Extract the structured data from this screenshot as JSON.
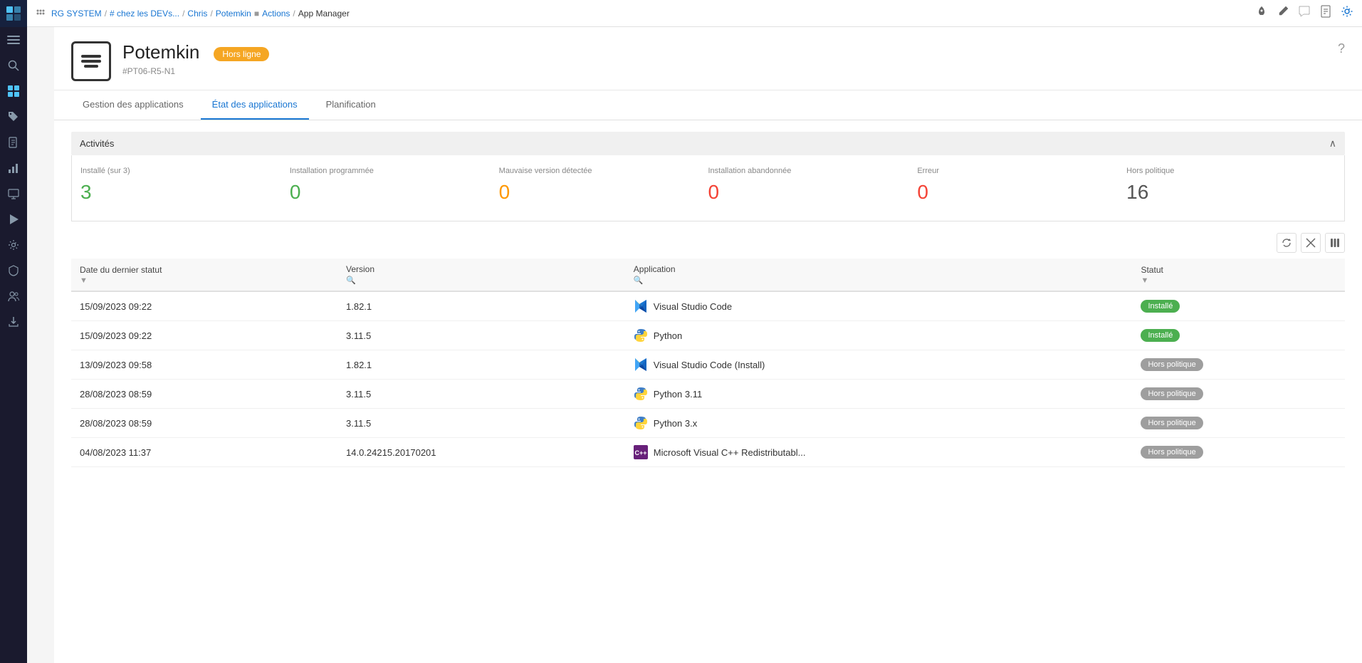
{
  "topbar": {
    "breadcrumb": [
      {
        "label": "RG SYSTEM",
        "type": "link"
      },
      {
        "label": "# chez les DEVs...",
        "type": "link"
      },
      {
        "label": "Chris",
        "type": "link"
      },
      {
        "label": "Potemkin",
        "type": "link"
      },
      {
        "label": "Actions",
        "type": "separator"
      },
      {
        "label": "App Manager",
        "type": "current"
      }
    ]
  },
  "page": {
    "device_id": "#PT06-R5-N1",
    "title": "Potemkin",
    "status": "Hors ligne",
    "help_label": "?"
  },
  "tabs": [
    {
      "label": "Gestion des applications",
      "active": false
    },
    {
      "label": "État des applications",
      "active": true
    },
    {
      "label": "Planification",
      "active": false
    }
  ],
  "activities": {
    "title": "Activités",
    "items": [
      {
        "label": "Installé (sur 3)",
        "value": "3",
        "color": "green"
      },
      {
        "label": "Installation programmée",
        "value": "0",
        "color": "green"
      },
      {
        "label": "Mauvaise version détectée",
        "value": "0",
        "color": "orange"
      },
      {
        "label": "Installation abandonnée",
        "value": "0",
        "color": "red"
      },
      {
        "label": "Erreur",
        "value": "0",
        "color": "red"
      },
      {
        "label": "Hors politique",
        "value": "16",
        "color": "dark"
      }
    ]
  },
  "table": {
    "columns": [
      {
        "label": "Date du dernier statut",
        "has_filter": true,
        "has_search": false
      },
      {
        "label": "Version",
        "has_filter": false,
        "has_search": true
      },
      {
        "label": "Application",
        "has_filter": false,
        "has_search": true
      },
      {
        "label": "Statut",
        "has_filter": true,
        "has_search": false
      }
    ],
    "rows": [
      {
        "date": "15/09/2023 09:22",
        "version": "1.82.1",
        "app_name": "Visual Studio Code",
        "app_icon": "vscode",
        "status": "Installé",
        "status_type": "installed"
      },
      {
        "date": "15/09/2023 09:22",
        "version": "3.11.5",
        "app_name": "Python",
        "app_icon": "python",
        "status": "Installé",
        "status_type": "installed"
      },
      {
        "date": "13/09/2023 09:58",
        "version": "1.82.1",
        "app_name": "Visual Studio Code (Install)",
        "app_icon": "vscode",
        "status": "Hors politique",
        "status_type": "policy"
      },
      {
        "date": "28/08/2023 08:59",
        "version": "3.11.5",
        "app_name": "Python 3.11",
        "app_icon": "python",
        "status": "Hors politique",
        "status_type": "policy"
      },
      {
        "date": "28/08/2023 08:59",
        "version": "3.11.5",
        "app_name": "Python 3.x",
        "app_icon": "python",
        "status": "Hors politique",
        "status_type": "policy"
      },
      {
        "date": "04/08/2023 11:37",
        "version": "14.0.24215.20170201",
        "app_name": "Microsoft Visual C++ Redistributabl...",
        "app_icon": "msvc",
        "status": "Hors politique",
        "status_type": "policy"
      }
    ]
  },
  "sidebar_icons": [
    {
      "name": "menu",
      "symbol": "☰"
    },
    {
      "name": "search",
      "symbol": "🔍"
    },
    {
      "name": "grid",
      "symbol": "⊞"
    },
    {
      "name": "tag",
      "symbol": "🏷"
    },
    {
      "name": "document",
      "symbol": "📋"
    },
    {
      "name": "chart",
      "symbol": "📊"
    },
    {
      "name": "monitor",
      "symbol": "🖥"
    },
    {
      "name": "play",
      "symbol": "▶"
    },
    {
      "name": "settings",
      "symbol": "⚙"
    },
    {
      "name": "shield",
      "symbol": "🛡"
    },
    {
      "name": "users",
      "symbol": "👥"
    },
    {
      "name": "download",
      "symbol": "⬇"
    }
  ]
}
